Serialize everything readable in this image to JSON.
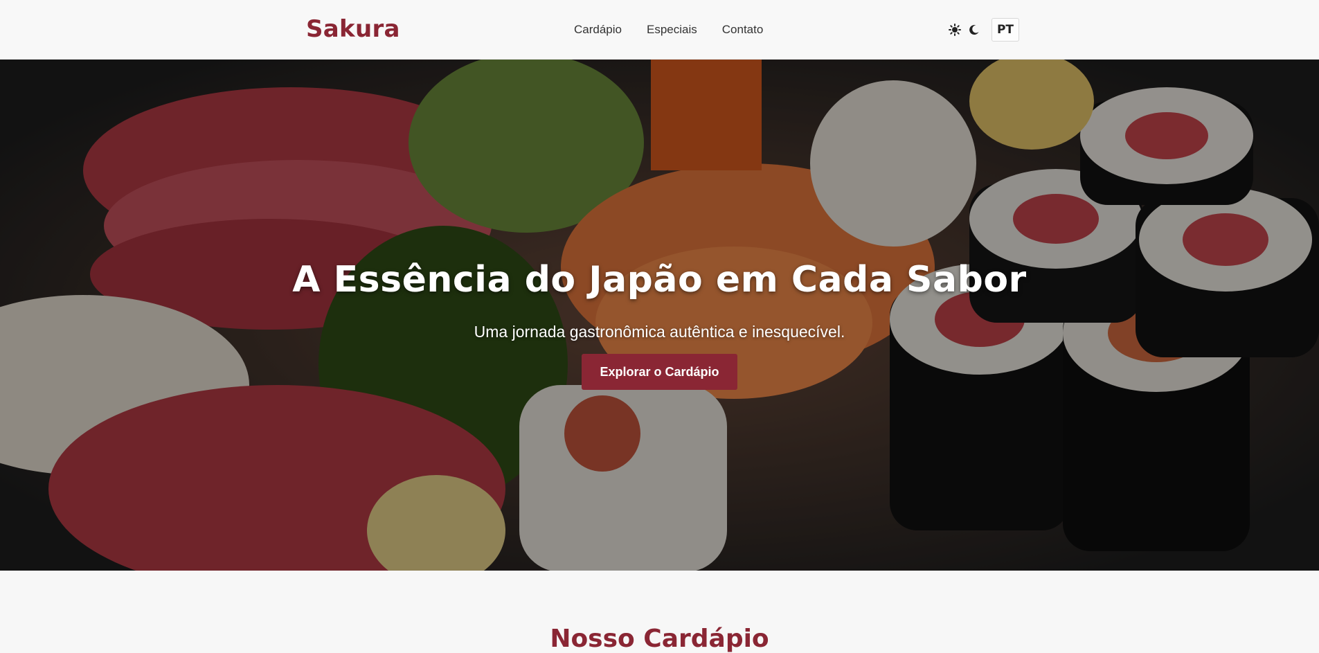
{
  "header": {
    "logo": "Sakura",
    "nav": [
      {
        "label": "Cardápio"
      },
      {
        "label": "Especiais"
      },
      {
        "label": "Contato"
      }
    ],
    "theme_icons": [
      "sun-icon",
      "moon-icon"
    ],
    "language": "PT"
  },
  "hero": {
    "title": "A Essência do Japão em Cada Sabor",
    "subtitle": "Uma jornada gastronômica autêntica e inesquecível.",
    "cta_label": "Explorar o Cardápio"
  },
  "menu_section": {
    "title": "Nosso Cardápio"
  },
  "colors": {
    "brand": "#8a2634",
    "header_bg": "#f8f8f8",
    "page_bg": "#f7f7f7"
  }
}
